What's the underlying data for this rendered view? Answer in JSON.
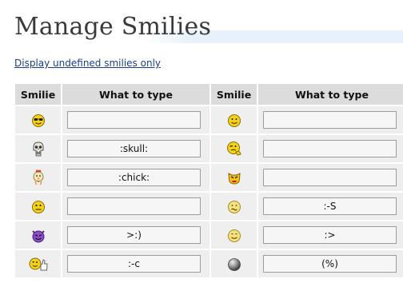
{
  "page": {
    "title": "Manage Smilies",
    "undefined_link": "Display undefined smilies only"
  },
  "table": {
    "headers": [
      "Smilie",
      "What to type",
      "Smilie",
      "What to type"
    ],
    "rows": [
      [
        {
          "icon": "cool-smilie-icon",
          "code": ""
        },
        {
          "icon": "smile-smilie-icon",
          "code": ""
        }
      ],
      [
        {
          "icon": "skull-smilie-icon",
          "code": ":skull:"
        },
        {
          "icon": "peek-smilie-icon",
          "code": ""
        }
      ],
      [
        {
          "icon": "chick-smilie-icon",
          "code": ":chick:"
        },
        {
          "icon": "angry-cat-smilie-icon",
          "code": ""
        }
      ],
      [
        {
          "icon": "worried-smilie-icon",
          "code": ""
        },
        {
          "icon": "confused-smilie-icon",
          "code": ":-S"
        }
      ],
      [
        {
          "icon": "devil-smilie-icon",
          "code": ">:)"
        },
        {
          "icon": "grin-smilie-icon",
          "code": ":>"
        }
      ],
      [
        {
          "icon": "thumbs-up-smilie-icon",
          "code": ":-c"
        },
        {
          "icon": "gray-ball-icon",
          "code": "(%)"
        }
      ]
    ]
  },
  "colors": {
    "title_band": "#e6f1fb",
    "header_bg": "#dcdcdc",
    "cell_bg": "#eeeeee",
    "link": "#1a3e8c",
    "smilie_yellow": "#f5d21a"
  }
}
